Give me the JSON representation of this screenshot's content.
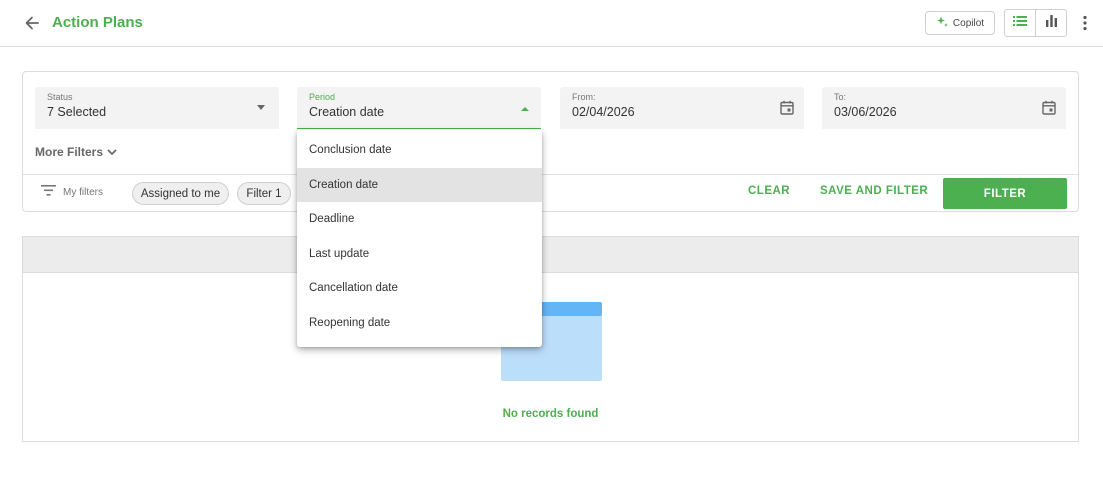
{
  "header": {
    "title": "Action Plans",
    "copilot_label": "Copilot",
    "accent_color": "#4caf50"
  },
  "filters": {
    "status": {
      "label": "Status",
      "value": "7 Selected"
    },
    "period": {
      "label": "Period",
      "value": "Creation date"
    },
    "from": {
      "label": "From:",
      "value": "02/04/2026"
    },
    "to": {
      "label": "To:",
      "value": "03/06/2026"
    },
    "more_filters": "More Filters",
    "my_filters": "My filters",
    "chips": [
      "Assigned to me",
      "Filter 1"
    ],
    "clear": "CLEAR",
    "save_and_filter": "SAVE AND FILTER",
    "filter": "FILTER"
  },
  "period_dropdown": {
    "options": [
      "Conclusion date",
      "Creation date",
      "Deadline",
      "Last update",
      "Cancellation date",
      "Reopening date"
    ],
    "selected": "Creation date"
  },
  "results": {
    "empty_message": "No records found"
  },
  "icons": {
    "back": "arrow-left-icon",
    "copilot": "sparkle-icon",
    "list_view": "list-icon",
    "chart_view": "bar-chart-icon",
    "more": "kebab-icon",
    "calendar": "calendar-icon",
    "filter": "filter-lines-icon",
    "more_filters": "chevron-down-icon"
  }
}
